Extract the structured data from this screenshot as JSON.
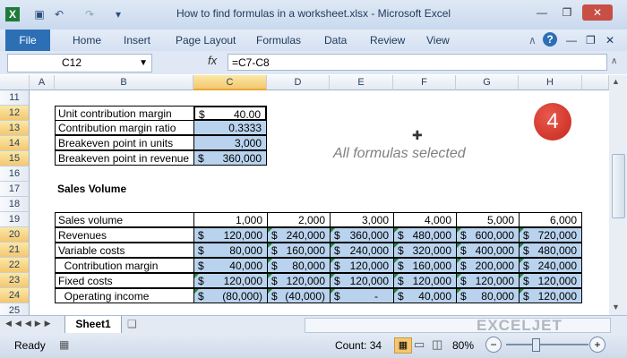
{
  "window": {
    "title": "How to find formulas in a worksheet.xlsx  -  Microsoft Excel"
  },
  "ribbon": {
    "file": "File",
    "tabs": [
      "Home",
      "Insert",
      "Page Layout",
      "Formulas",
      "Data",
      "Review",
      "View"
    ]
  },
  "formula_bar": {
    "name_box": "C12",
    "fx": "fx",
    "formula": "=C7-C8"
  },
  "columns": [
    "A",
    "B",
    "C",
    "D",
    "E",
    "F",
    "G",
    "H"
  ],
  "rows": [
    "11",
    "12",
    "13",
    "14",
    "15",
    "16",
    "17",
    "18",
    "19",
    "20",
    "21",
    "22",
    "23",
    "24",
    "25"
  ],
  "summary": {
    "labels": [
      "Unit contribution margin",
      "Contribution margin ratio",
      "Breakeven point in units",
      "Breakeven point in revenue"
    ],
    "values": [
      "40.00",
      "0.3333",
      "3,000",
      "360,000"
    ]
  },
  "sales_title": "Sales Volume",
  "volume_row": {
    "label": "Sales volume",
    "values": [
      "1,000",
      "2,000",
      "3,000",
      "4,000",
      "5,000",
      "6,000"
    ]
  },
  "table_rows": [
    {
      "label": "Revenues",
      "values": [
        "120,000",
        "240,000",
        "360,000",
        "480,000",
        "600,000",
        "720,000"
      ]
    },
    {
      "label": "Variable costs",
      "values": [
        "80,000",
        "160,000",
        "240,000",
        "320,000",
        "400,000",
        "480,000"
      ]
    },
    {
      "label": "  Contribution margin",
      "values": [
        "40,000",
        "80,000",
        "120,000",
        "160,000",
        "200,000",
        "240,000"
      ]
    },
    {
      "label": "Fixed costs",
      "values": [
        "120,000",
        "120,000",
        "120,000",
        "120,000",
        "120,000",
        "120,000"
      ]
    },
    {
      "label": "  Operating income",
      "values": [
        "(80,000)",
        "(40,000)",
        "-",
        "40,000",
        "80,000",
        "120,000"
      ]
    }
  ],
  "currency": "$",
  "badge": "4",
  "note": "All formulas selected",
  "sheet_tab": "Sheet1",
  "brand": "EXCELJET",
  "status": {
    "ready": "Ready",
    "count": "Count: 34",
    "zoom": "80%"
  },
  "colors": {
    "selection": "#b9d3ee",
    "badge": "#d5372b",
    "formula_marker": "#1f8a3b"
  }
}
